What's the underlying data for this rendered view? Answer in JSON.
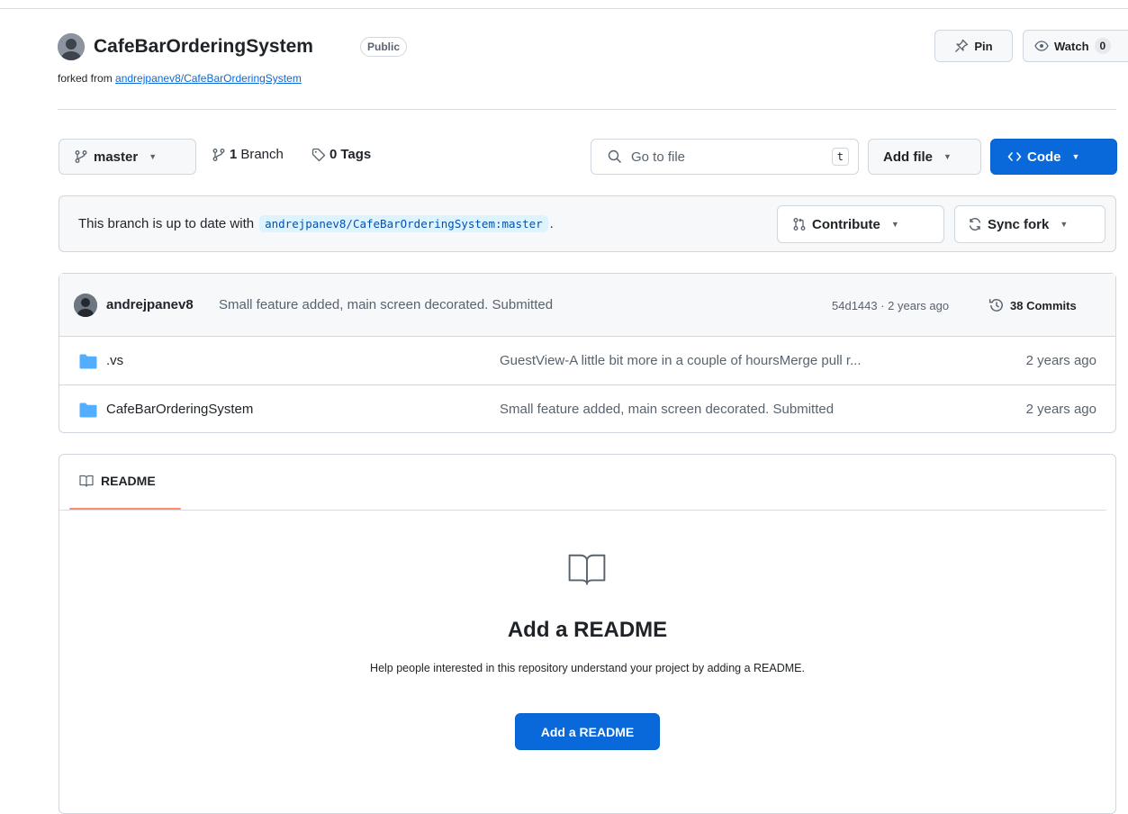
{
  "repo": {
    "name": "CafeBarOrderingSystem",
    "visibility": "Public",
    "forked_prefix": "forked from",
    "forked_link": "andrejpanev8/CafeBarOrderingSystem"
  },
  "header_actions": {
    "pin_label": "Pin",
    "watch_label": "Watch",
    "watch_count": "0"
  },
  "toolbar": {
    "branch_name": "master",
    "branches_count": "1",
    "branches_label": "Branch",
    "tags_count": "0",
    "tags_label": "Tags",
    "goto_placeholder": "Go to file",
    "goto_shortcut": "t",
    "add_file_label": "Add file",
    "code_label": "Code"
  },
  "branch_status": {
    "prefix": "This branch is up to date with",
    "ref": "andrejpanev8/CafeBarOrderingSystem:master",
    "suffix": ".",
    "contribute_label": "Contribute",
    "sync_label": "Sync fork"
  },
  "latest_commit": {
    "author": "andrejpanev8",
    "message": "Small feature added, main screen decorated. Submitted",
    "meta": "54d1443 · 2 years ago",
    "commits_label": "38 Commits"
  },
  "files": [
    {
      "name": ".vs",
      "message": "GuestView-A little bit more in a couple of hoursMerge pull r...",
      "time": "2 years ago"
    },
    {
      "name": "CafeBarOrderingSystem",
      "message": "Small feature added, main screen decorated. Submitted",
      "time": "2 years ago"
    }
  ],
  "readme": {
    "tab_label": "README",
    "title": "Add a README",
    "description": "Help people interested in this repository understand your project by adding a README.",
    "button_label": "Add a README"
  },
  "colors": {
    "accent": "#0969da",
    "folder": "#54aeff",
    "tab_underline": "#fd8c73"
  }
}
